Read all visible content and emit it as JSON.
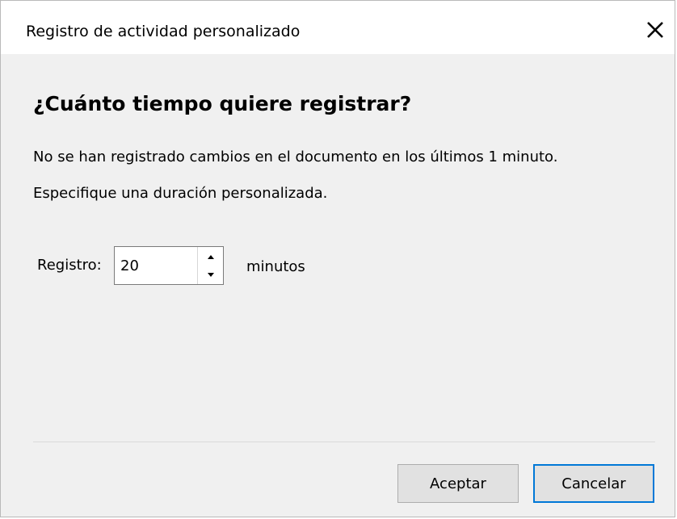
{
  "window": {
    "title": "Registro de actividad personalizado",
    "close_icon": "close-icon"
  },
  "content": {
    "heading": "¿Cuánto tiempo quiere registrar?",
    "description_line1": "No se han registrado cambios en el documento en los últimos 1 minuto.",
    "description_line2": "Especifique una duración personalizada."
  },
  "duration": {
    "label": "Registro:",
    "value": "20",
    "unit": "minutos",
    "up_icon": "spin-up-icon",
    "down_icon": "spin-down-icon"
  },
  "buttons": {
    "accept_label": "Aceptar",
    "cancel_label": "Cancelar"
  },
  "colors": {
    "dialog_background": "#f0f0f0",
    "titlebar_background": "#ffffff",
    "button_background": "#e1e1e1",
    "focus_border": "#0078d7"
  }
}
